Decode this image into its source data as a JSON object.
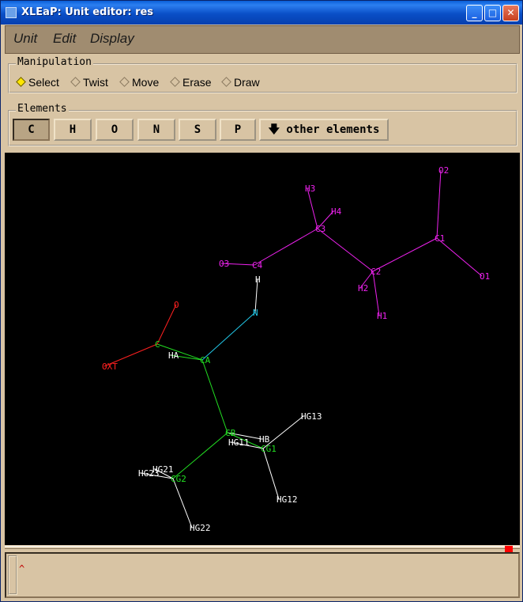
{
  "window": {
    "title": "XLEaP: Unit editor: res"
  },
  "titlebar": {
    "minimize_label": "_",
    "maximize_label": "□",
    "close_label": "✕"
  },
  "menu": {
    "items": [
      "Unit",
      "Edit",
      "Display"
    ]
  },
  "manipulation": {
    "title": "Manipulation",
    "modes": [
      "Select",
      "Twist",
      "Move",
      "Erase",
      "Draw"
    ],
    "selected": "Select"
  },
  "elements": {
    "title": "Elements",
    "buttons": [
      "C",
      "H",
      "O",
      "N",
      "S",
      "P"
    ],
    "pressed": "C",
    "other_label": "other elements"
  },
  "colors": {
    "carbon": "#22e022",
    "hydrogen": "#ffffff",
    "oxygen": "#ff2020",
    "nitrogen": "#22c8e8",
    "selected": "#ee22ee",
    "canvas_bg": "#000000",
    "status": "#ff0000"
  },
  "molecule": {
    "atoms": [
      {
        "name": "O2",
        "color": "selected"
      },
      {
        "name": "H3",
        "color": "selected"
      },
      {
        "name": "H4",
        "color": "selected"
      },
      {
        "name": "C3",
        "color": "selected"
      },
      {
        "name": "C1",
        "color": "selected"
      },
      {
        "name": "O3",
        "color": "selected"
      },
      {
        "name": "C4",
        "color": "selected"
      },
      {
        "name": "C2",
        "color": "selected"
      },
      {
        "name": "O1",
        "color": "selected"
      },
      {
        "name": "H2",
        "color": "selected"
      },
      {
        "name": "H1",
        "color": "selected"
      },
      {
        "name": "H",
        "color": "hydrogen"
      },
      {
        "name": "N",
        "color": "nitrogen"
      },
      {
        "name": "O",
        "color": "oxygen"
      },
      {
        "name": "C",
        "color": "carbon"
      },
      {
        "name": "HA",
        "color": "hydrogen"
      },
      {
        "name": "CA",
        "color": "carbon"
      },
      {
        "name": "OXT",
        "color": "oxygen"
      },
      {
        "name": "HG13",
        "color": "hydrogen"
      },
      {
        "name": "CB",
        "color": "carbon"
      },
      {
        "name": "HB",
        "color": "hydrogen"
      },
      {
        "name": "HG11",
        "color": "hydrogen"
      },
      {
        "name": "CG1",
        "color": "carbon"
      },
      {
        "name": "HG21",
        "color": "hydrogen"
      },
      {
        "name": "HG23",
        "color": "hydrogen"
      },
      {
        "name": "CG2",
        "color": "carbon"
      },
      {
        "name": "HG12",
        "color": "hydrogen"
      },
      {
        "name": "HG22",
        "color": "hydrogen"
      }
    ]
  },
  "output": {
    "prompt": "^"
  }
}
